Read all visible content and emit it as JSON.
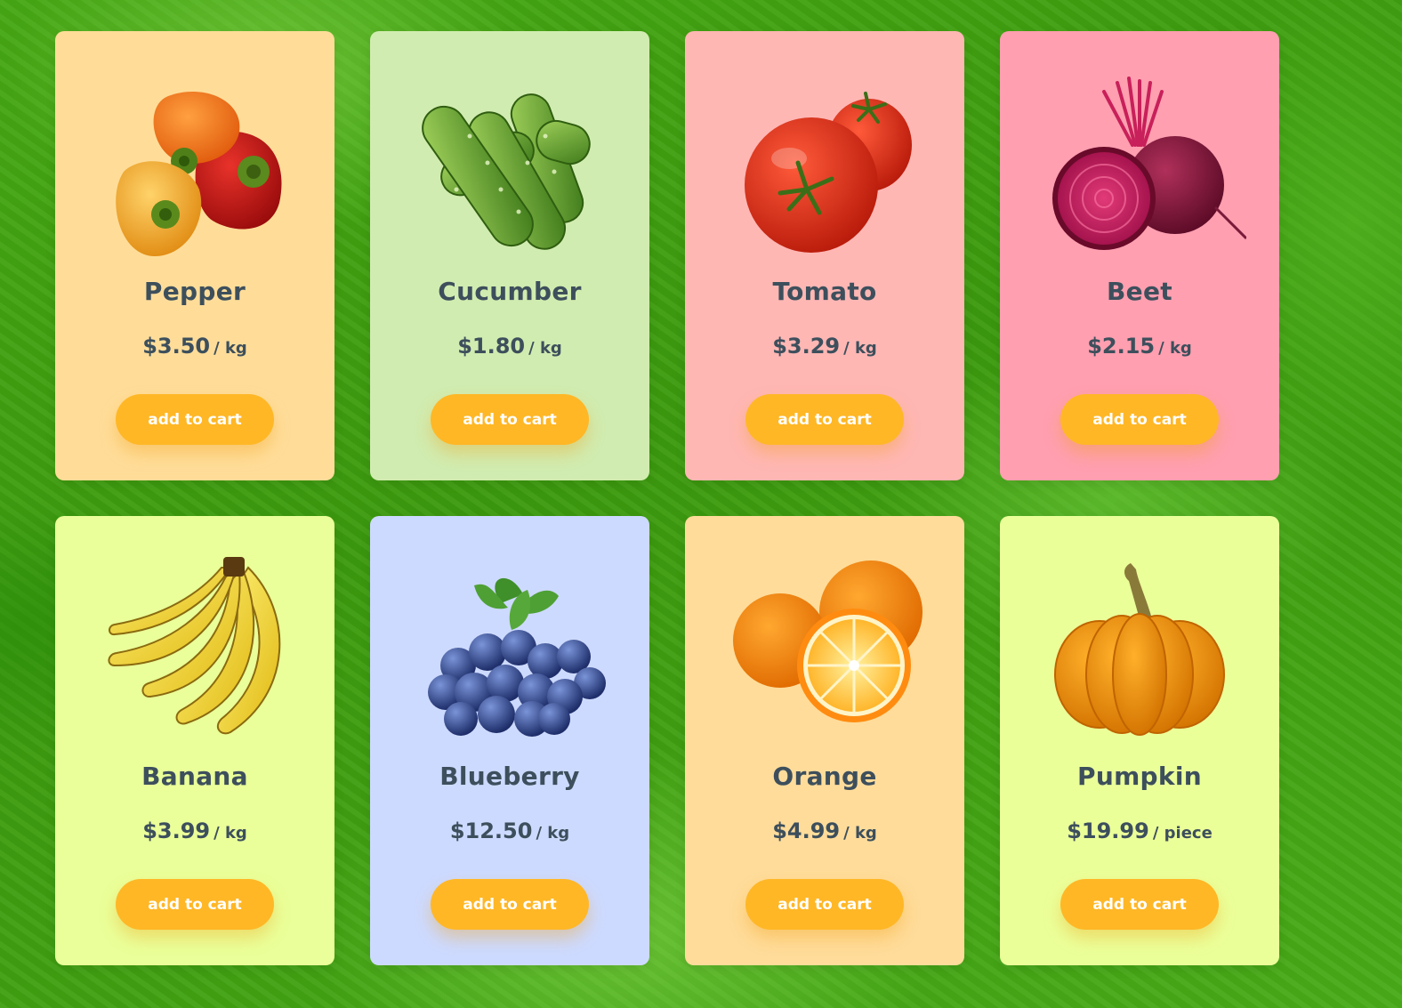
{
  "products": [
    {
      "name": "Pepper",
      "price": "$3.50",
      "unit": "/ kg",
      "button": "add to cart",
      "card_color": "#ffdd99",
      "icon": "pepper-icon"
    },
    {
      "name": "Cucumber",
      "price": "$1.80",
      "unit": "/ kg",
      "button": "add to cart",
      "card_color": "#d1ecb0",
      "icon": "cucumber-icon"
    },
    {
      "name": "Tomato",
      "price": "$3.29",
      "unit": "/ kg",
      "button": "add to cart",
      "card_color": "#ffb7b4",
      "icon": "tomato-icon"
    },
    {
      "name": "Beet",
      "price": "$2.15",
      "unit": "/ kg",
      "button": "add to cart",
      "card_color": "#ff9fb0",
      "icon": "beet-icon"
    },
    {
      "name": "Banana",
      "price": "$3.99",
      "unit": "/ kg",
      "button": "add to cart",
      "card_color": "#eaff99",
      "icon": "banana-icon"
    },
    {
      "name": "Blueberry",
      "price": "$12.50",
      "unit": "/ kg",
      "button": "add to cart",
      "card_color": "#cddaff",
      "icon": "blueberry-icon"
    },
    {
      "name": "Orange",
      "price": "$4.99",
      "unit": "/ kg",
      "button": "add to cart",
      "card_color": "#ffdc9a",
      "icon": "orange-icon"
    },
    {
      "name": "Pumpkin",
      "price": "$19.99",
      "unit": "/ piece",
      "button": "add to cart",
      "card_color": "#ebff99",
      "icon": "pumpkin-icon"
    }
  ],
  "colors": {
    "button": "#ffb726",
    "text": "#3d4f5c",
    "background": "#3f9c10"
  }
}
